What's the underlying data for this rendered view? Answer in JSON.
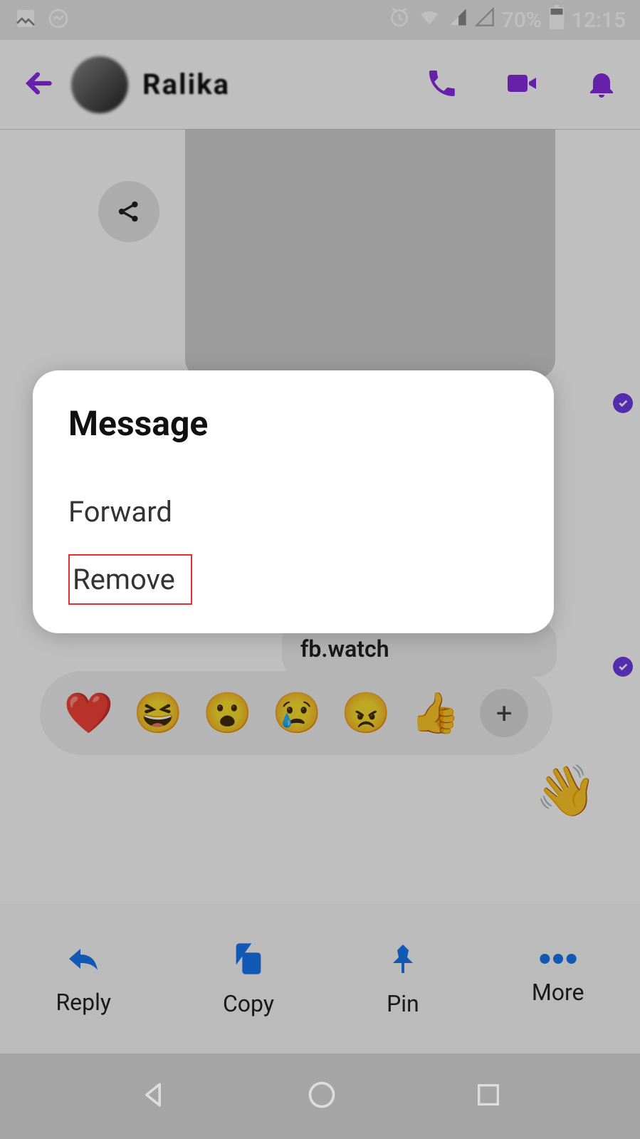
{
  "status": {
    "battery": "70%",
    "time": "12:15"
  },
  "header": {
    "contact_name": "Ralika"
  },
  "chat": {
    "link_text": "fb.watch"
  },
  "reactions": {
    "heart": "❤️",
    "laugh": "😆",
    "wow": "😮",
    "sad": "😢",
    "angry": "😠",
    "like": "👍",
    "add": "+"
  },
  "actions": {
    "reply": "Reply",
    "copy": "Copy",
    "pin": "Pin",
    "more": "More"
  },
  "dialog": {
    "title": "Message",
    "forward": "Forward",
    "remove": "Remove"
  }
}
